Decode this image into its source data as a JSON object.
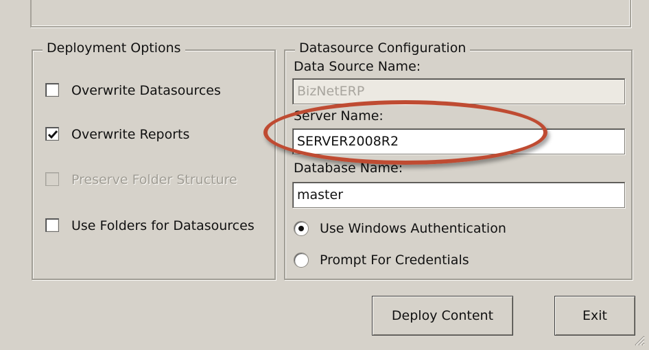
{
  "deployment_options": {
    "title": "Deployment Options",
    "overwrite_datasources": {
      "label": "Overwrite Datasources",
      "checked": false,
      "enabled": true
    },
    "overwrite_reports": {
      "label": "Overwrite Reports",
      "checked": true,
      "enabled": true
    },
    "preserve_folder_structure": {
      "label": "Preserve Folder Structure",
      "checked": false,
      "enabled": false
    },
    "use_folders_for_datasources": {
      "label": "Use Folders for Datasources",
      "checked": false,
      "enabled": true
    }
  },
  "datasource_configuration": {
    "title": "Datasource Configuration",
    "data_source_name": {
      "label": "Data Source Name:",
      "value": "BizNetERP",
      "read_only": true
    },
    "server_name": {
      "label": "Server Name:",
      "value": "SERVER2008R2"
    },
    "database_name": {
      "label": "Database Name:",
      "value": "master"
    },
    "auth_options": [
      {
        "label": "Use Windows Authentication",
        "selected": true
      },
      {
        "label": "Prompt For Credentials",
        "selected": false
      }
    ]
  },
  "buttons": {
    "deploy": "Deploy Content",
    "exit": "Exit"
  },
  "annotation": {
    "color": "#bf4b32"
  }
}
